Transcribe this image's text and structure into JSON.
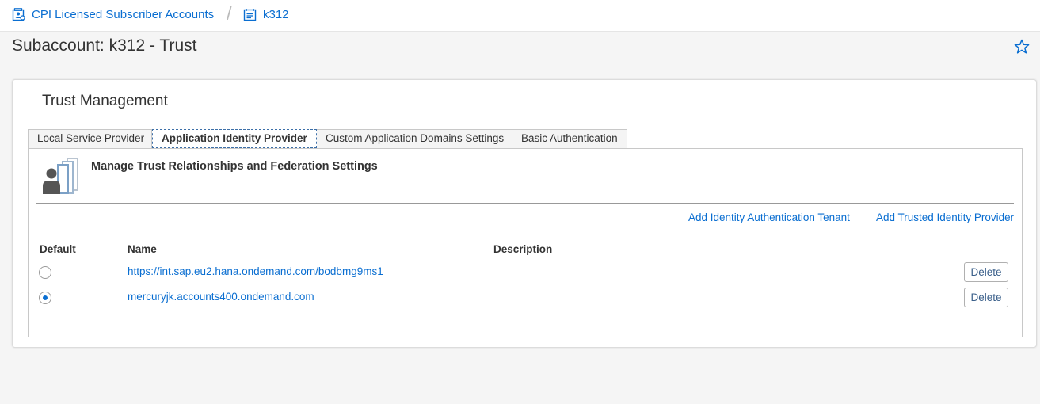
{
  "breadcrumb": {
    "items": [
      {
        "label": "CPI Licensed Subscriber Accounts",
        "icon": "global-account-icon"
      },
      {
        "label": "k312",
        "icon": "subaccount-icon"
      }
    ],
    "separator": "/"
  },
  "page": {
    "title": "Subaccount: k312 - Trust",
    "favorite_icon": "star-icon"
  },
  "card": {
    "title": "Trust Management",
    "tabs": [
      {
        "label": "Local Service Provider",
        "active": false
      },
      {
        "label": "Application Identity Provider",
        "active": true
      },
      {
        "label": "Custom Application Domains Settings",
        "active": false
      },
      {
        "label": "Basic Authentication",
        "active": false
      }
    ],
    "panel": {
      "icon": "trust-users-icon",
      "heading": "Manage Trust Relationships and Federation Settings",
      "actions": [
        {
          "label": "Add Identity Authentication Tenant"
        },
        {
          "label": "Add Trusted Identity Provider"
        }
      ],
      "table": {
        "columns": [
          "Default",
          "Name",
          "Description"
        ],
        "rows": [
          {
            "default": false,
            "name": "https://int.sap.eu2.hana.ondemand.com/bodbmg9ms1",
            "description": "",
            "delete_label": "Delete"
          },
          {
            "default": true,
            "name": "mercuryjk.accounts400.ondemand.com",
            "description": "",
            "delete_label": "Delete"
          }
        ]
      }
    }
  },
  "colors": {
    "link": "#0a6ed1",
    "background": "#f5f5f5"
  }
}
